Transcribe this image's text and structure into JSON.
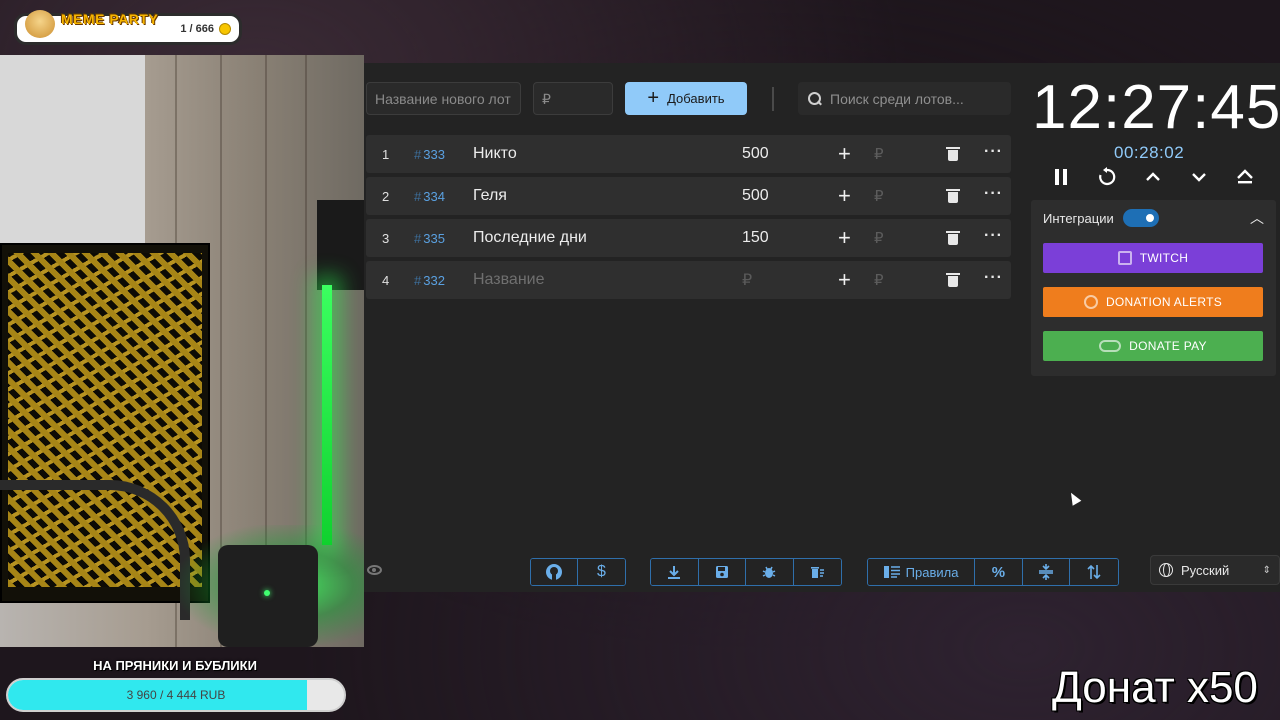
{
  "overlay": {
    "meme_title": "MEME PARTY",
    "meme_count": "1 / 666",
    "goal_title": "НА ПРЯНИКИ И БУБЛИКИ",
    "goal_text": "3 960 / 4 444 RUB",
    "goal_progress_fraction": 0.891,
    "donate_caption": "Донат x50"
  },
  "toolbar": {
    "new_lot_placeholder": "Название нового лот",
    "amount_placeholder": "₽",
    "add_label": "Добавить",
    "search_placeholder": "Поиск среди лотов..."
  },
  "lots": [
    {
      "num": "1",
      "id": "333",
      "name": "Никто",
      "amount": "500",
      "rub": "₽"
    },
    {
      "num": "2",
      "id": "334",
      "name": "Геля",
      "amount": "500",
      "rub": "₽"
    },
    {
      "num": "3",
      "id": "335",
      "name": "Последние дни",
      "amount": "150",
      "rub": "₽"
    },
    {
      "num": "4",
      "id": "332",
      "name": "Название",
      "amount": "₽",
      "rub": "₽"
    }
  ],
  "timer": {
    "main": "12:27:45",
    "sub": "00:28:02"
  },
  "integrations": {
    "title": "Интеграции",
    "enabled": true,
    "twitch_label": "TWITCH",
    "donation_alerts_label": "DONATION ALERTS",
    "donate_pay_label": "DONATE PAY",
    "colors": {
      "twitch": "#7b3fd8",
      "donation_alerts": "#ef7d1d",
      "donate_pay": "#4caf50"
    }
  },
  "bottom": {
    "rules_label": "Правила",
    "language": "Русский",
    "dollar_symbol": "$",
    "percent_symbol": "%"
  },
  "icons": [
    "search-icon",
    "plus-icon",
    "trash-icon",
    "more-icon",
    "pause-icon",
    "restart-icon",
    "chevron-up-icon",
    "chevron-down-icon",
    "eject-icon",
    "github-icon",
    "download-icon",
    "save-icon",
    "bug-icon",
    "clear-icon",
    "globe-icon",
    "eye-icon"
  ]
}
